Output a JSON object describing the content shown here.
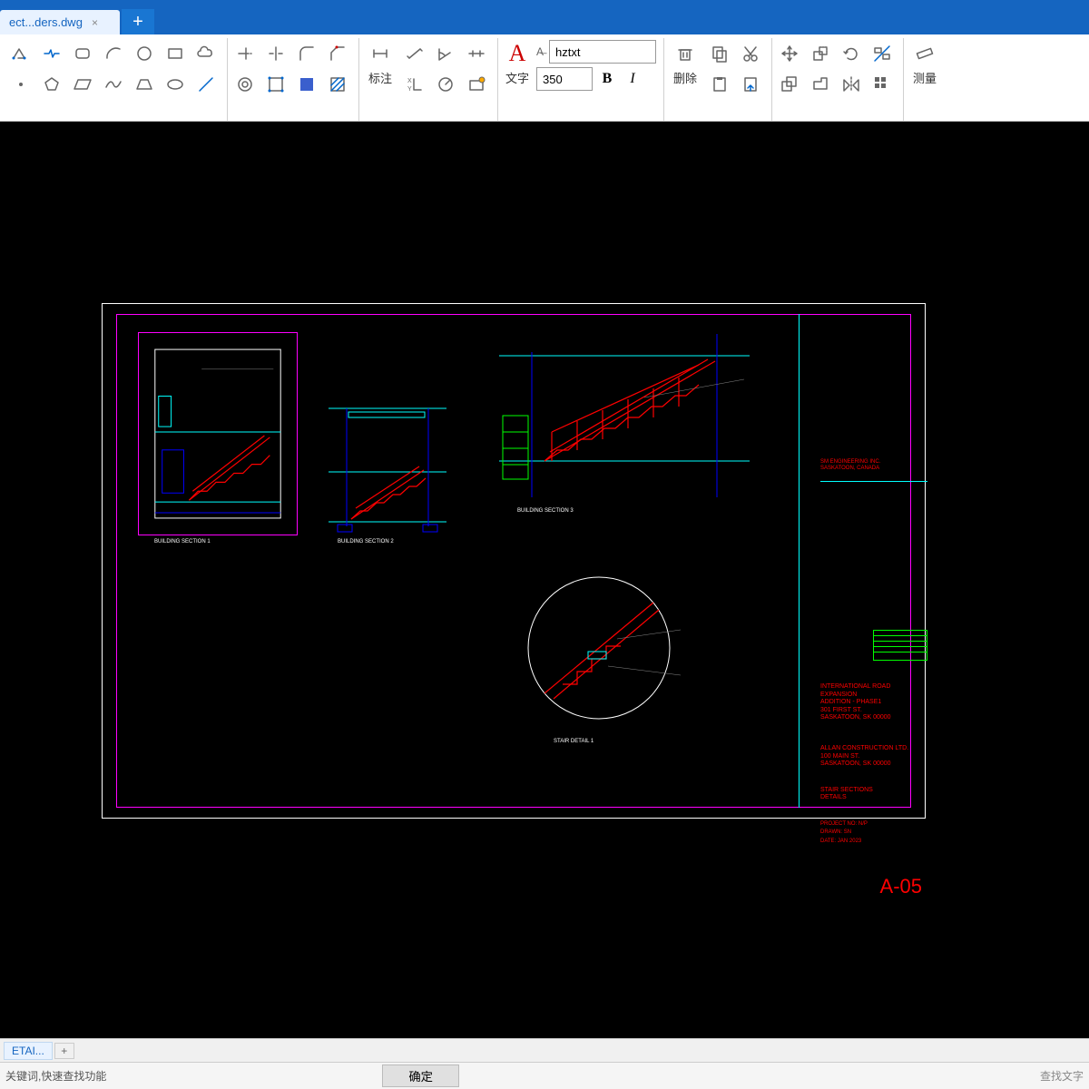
{
  "tab": {
    "filename": "ect...ders.dwg"
  },
  "ribbon": {
    "annotation_label": "标注",
    "text_label": "文字",
    "font_name": "hztxt",
    "text_size": "350",
    "bold": "B",
    "italic": "I",
    "delete_label": "删除",
    "measure_label": "测量"
  },
  "drawing": {
    "sheet_number": "A-05",
    "title": "STAIR SECTIONS\nDETAILS",
    "company1": "SM  ENGINEERING INC.\nSASKATOON, CANADA",
    "project": "INTERNATIONAL ROAD EXPANSION\nADDITION - PHASE1\n301 FIRST ST.\nSASKATOON, SK  00000",
    "contractor": "ALLAN CONSTRUCTION LTD.\n100 MAIN ST.\nSASKATOON, SK  00000",
    "meta1": "PROJECT NO:      N/P",
    "meta2": "DRAWN:             SN",
    "meta3": "DATE:         JAN 2023",
    "caption1": "BUILDING SECTION  1",
    "caption2": "BUILDING SECTION  2",
    "caption3": "BUILDING SECTION  3",
    "caption4": "STAIR DETAIL  1"
  },
  "layout_tab": "ETAI...",
  "status": {
    "hint": "关键词,快速查找功能",
    "confirm": "确定",
    "find": "查找文字"
  }
}
